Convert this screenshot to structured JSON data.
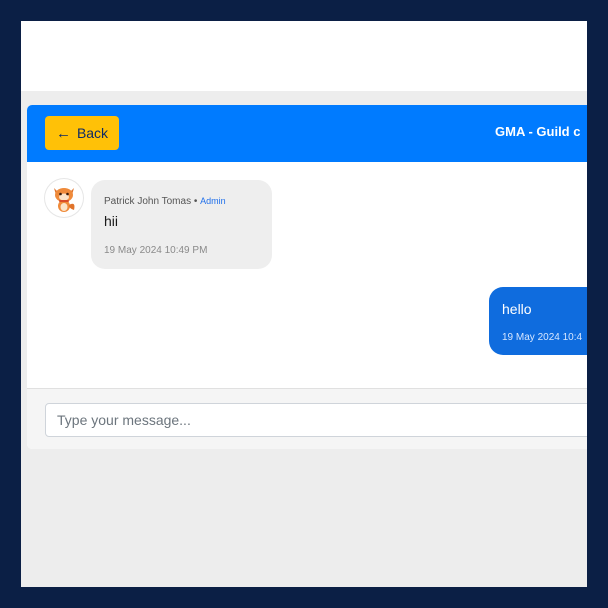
{
  "header": {
    "back_label": "Back",
    "title": "GMA - Guild c"
  },
  "messages": [
    {
      "sender": "Patrick John Tomas",
      "separator": " • ",
      "role": "Admin",
      "text": "hii",
      "time": "19 May 2024 10:49 PM",
      "direction": "incoming"
    },
    {
      "text": "hello",
      "time": "19 May 2024 10:4",
      "direction": "outgoing"
    }
  ],
  "composer": {
    "placeholder": "Type your message..."
  },
  "colors": {
    "header": "#007bff",
    "back_button": "#ffc107",
    "outgoing_bubble": "#0f6cde",
    "incoming_bubble": "#eeeeee",
    "frame": "#0b1f45"
  },
  "icons": {
    "back": "arrow-left-icon",
    "avatar": "fox-character-avatar"
  }
}
